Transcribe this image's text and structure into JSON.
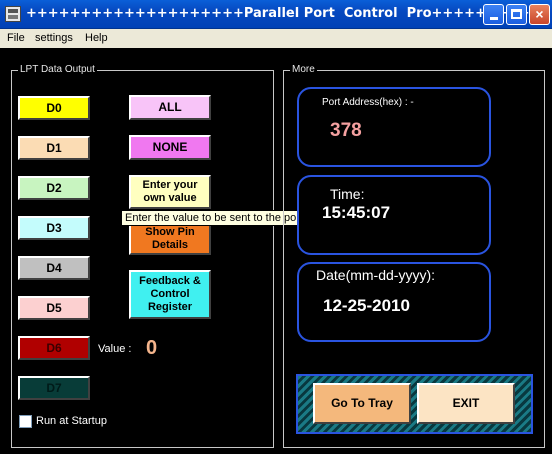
{
  "window": {
    "title": "++++++++++++++++++++Parallel Port  Control  Pro++++++++++++",
    "buttons": {
      "minimize": "minimize",
      "maximize": "maximize",
      "close": "×"
    }
  },
  "menu": [
    "File",
    "settings",
    "Help"
  ],
  "lpt_group": {
    "title": "LPT Data Output",
    "data_buttons": [
      {
        "label": "D0",
        "color": "#ffff00"
      },
      {
        "label": "D1",
        "color": "#fbdcb4"
      },
      {
        "label": "D2",
        "color": "#c8f4c0"
      },
      {
        "label": "D3",
        "color": "#c4fcfc"
      },
      {
        "label": "D4",
        "color": "#c0c0c0"
      },
      {
        "label": "D5",
        "color": "#fcd0d0"
      },
      {
        "label": "D6",
        "color": "#b00000"
      },
      {
        "label": "D7",
        "color": "#083c38"
      }
    ],
    "all_label": "ALL",
    "none_label": "NONE",
    "enter_value_label": "Enter your own value",
    "show_pin_label": "Show Pin Details",
    "feedback_label": "Feedback & Control Register",
    "value_caption": "Value :",
    "value": "0",
    "run_at_startup": "Run at Startup",
    "tooltip": "Enter the value to be sent to the port"
  },
  "more_group": {
    "title": "More",
    "port_address_label": "Port Address(hex) : -",
    "port_address_value": "378",
    "time_label": "Time:",
    "time_value": "15:45:07",
    "date_label": "Date(mm-dd-yyyy):",
    "date_value": "12-25-2010",
    "go_to_tray_label": "Go To Tray",
    "exit_label": "EXIT"
  }
}
